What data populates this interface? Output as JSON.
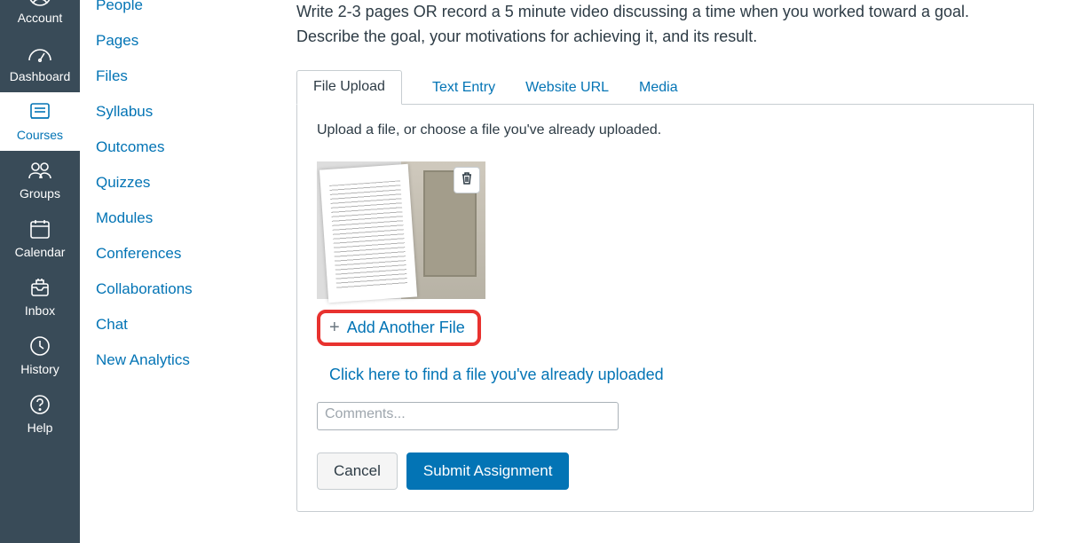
{
  "global_nav": {
    "account": "Account",
    "dashboard": "Dashboard",
    "courses": "Courses",
    "groups": "Groups",
    "calendar": "Calendar",
    "inbox": "Inbox",
    "history": "History",
    "help": "Help"
  },
  "course_nav": {
    "people": "People",
    "pages": "Pages",
    "files": "Files",
    "syllabus": "Syllabus",
    "outcomes": "Outcomes",
    "quizzes": "Quizzes",
    "modules": "Modules",
    "conferences": "Conferences",
    "collaborations": "Collaborations",
    "chat": "Chat",
    "new_analytics": "New Analytics"
  },
  "instructions": "Write 2-3 pages OR record a 5 minute video discussing a time when you worked toward a goal. Describe the goal, your motivations for achieving it, and its result.",
  "tabs": {
    "file_upload": "File Upload",
    "text_entry": "Text Entry",
    "website_url": "Website URL",
    "media": "Media"
  },
  "upload_panel": {
    "hint": "Upload a file, or choose a file you've already uploaded.",
    "add_another": "Add Another File",
    "find_existing": "Click here to find a file you've already uploaded",
    "comments_placeholder": "Comments...",
    "cancel": "Cancel",
    "submit": "Submit Assignment"
  }
}
